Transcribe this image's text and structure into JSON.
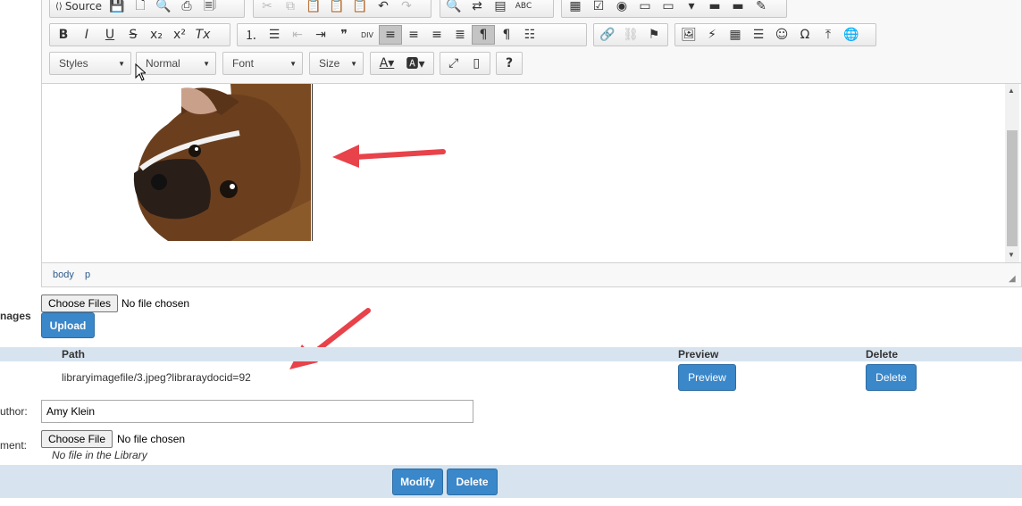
{
  "toolbar": {
    "source_label": "Source",
    "styles_label": "Styles",
    "format_label": "Normal",
    "font_label": "Font",
    "size_label": "Size",
    "help_label": "?"
  },
  "status_bar": {
    "path": [
      "body",
      "p"
    ]
  },
  "upload": {
    "row_label": "nages",
    "choose_label": "Choose Files",
    "no_file_text": "No file chosen",
    "upload_label": "Upload"
  },
  "table": {
    "headers": {
      "path": "Path",
      "preview": "Preview",
      "delete": "Delete"
    },
    "rows": [
      {
        "path": "libraryimagefile/3.jpeg?libraraydocid=92",
        "preview": "Preview",
        "delete": "Delete"
      }
    ]
  },
  "author": {
    "label": "uthor:",
    "value": "Amy Klein"
  },
  "attachment": {
    "label": "ment:",
    "choose_label": "Choose File",
    "no_file_text": "No file chosen",
    "library_text": "No file in the Library"
  },
  "footer": {
    "modify_label": "Modify",
    "delete_label": "Delete"
  },
  "colors": {
    "accent": "#3a87c9",
    "band": "#d7e4f0",
    "arrow": "#e8424a"
  }
}
